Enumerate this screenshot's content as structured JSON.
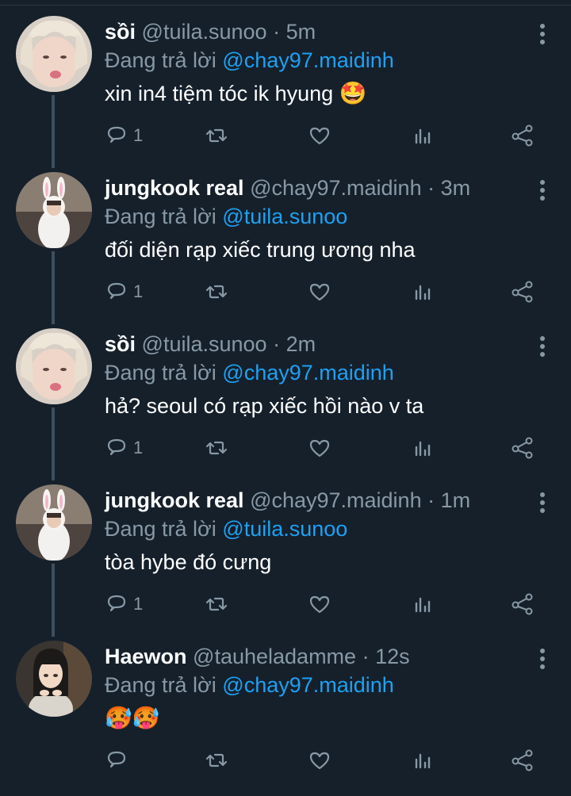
{
  "reply_prefix": "Đang trả lời",
  "tweets": [
    {
      "name": "sồi",
      "handle": "@tuila.sunoo",
      "time": "5m",
      "reply_to": "@chay97.maidinh",
      "text": "xin in4 tiệm tóc ik hyung",
      "emoji": "🤩",
      "reply_count": "1",
      "avatar": "blond-boy"
    },
    {
      "name": "jungkook real",
      "handle": "@chay97.maidinh",
      "time": "3m",
      "reply_to": "@tuila.sunoo",
      "text": "đối diện rạp xiếc trung ương nha",
      "emoji": "",
      "reply_count": "1",
      "avatar": "bunny"
    },
    {
      "name": "sồi",
      "handle": "@tuila.sunoo",
      "time": "2m",
      "reply_to": "@chay97.maidinh",
      "text": "hả? seoul có rạp xiếc hồi nào v ta",
      "emoji": "",
      "reply_count": "1",
      "avatar": "blond-boy"
    },
    {
      "name": "jungkook real",
      "handle": "@chay97.maidinh",
      "time": "1m",
      "reply_to": "@tuila.sunoo",
      "text": "tòa hybe đó cưng",
      "emoji": "",
      "reply_count": "1",
      "avatar": "bunny"
    },
    {
      "name": "Haewon",
      "handle": "@tauheladamme",
      "time": "12s",
      "reply_to": "@chay97.maidinh",
      "text": "",
      "emoji": "🥵🥵",
      "reply_count": "",
      "avatar": "girl"
    }
  ],
  "icons": {
    "reply": "reply-icon",
    "retweet": "retweet-icon",
    "like": "heart-icon",
    "stats": "stats-icon",
    "share": "share-icon",
    "more": "more-vertical-icon"
  },
  "colors": {
    "background": "#15202b",
    "mention": "#1da1f2",
    "secondary": "#8899a6"
  }
}
